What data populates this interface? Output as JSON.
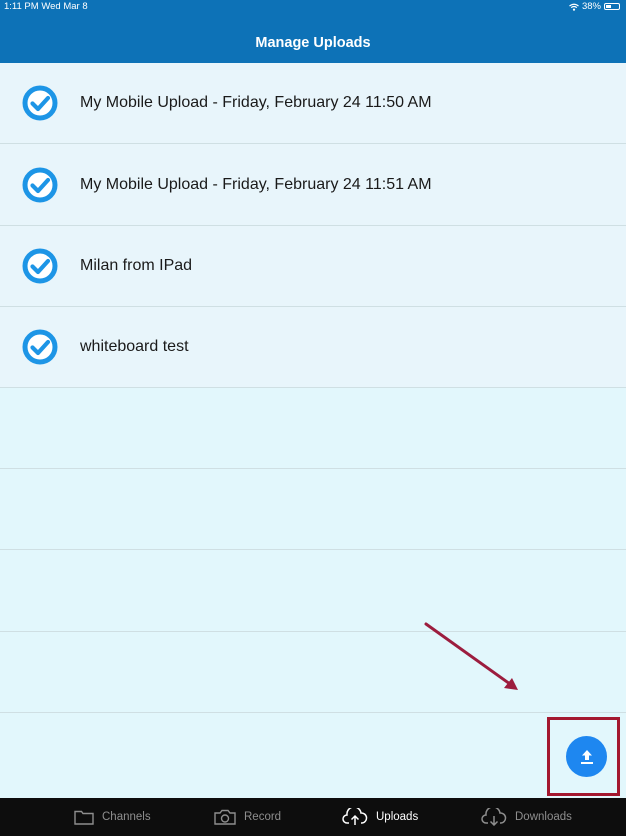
{
  "status_bar": {
    "time_date": "1:11 PM  Wed Mar 8",
    "battery_label": "38%",
    "wifi_icon": "wifi-icon",
    "battery_icon": "battery-icon"
  },
  "header": {
    "title": "Manage Uploads",
    "color": "#0d72b7"
  },
  "uploads": [
    {
      "label": "My Mobile Upload - Friday, February 24 11:50 AM",
      "status": "complete",
      "icon": "check-circle-icon"
    },
    {
      "label": "My Mobile Upload - Friday, February 24 11:51 AM",
      "status": "complete",
      "icon": "check-circle-icon"
    },
    {
      "label": "Milan from IPad",
      "status": "complete",
      "icon": "check-circle-icon"
    },
    {
      "label": "whiteboard test",
      "status": "complete",
      "icon": "check-circle-icon"
    }
  ],
  "fab": {
    "icon": "upload-icon",
    "color": "#1e87f0",
    "highlight_color": "#a3182f"
  },
  "tabs": [
    {
      "label": "Channels",
      "icon": "folder-icon",
      "active": false
    },
    {
      "label": "Record",
      "icon": "camera-icon",
      "active": false
    },
    {
      "label": "Uploads",
      "icon": "cloud-upload-icon",
      "active": true
    },
    {
      "label": "Downloads",
      "icon": "cloud-download-icon",
      "active": false
    }
  ]
}
